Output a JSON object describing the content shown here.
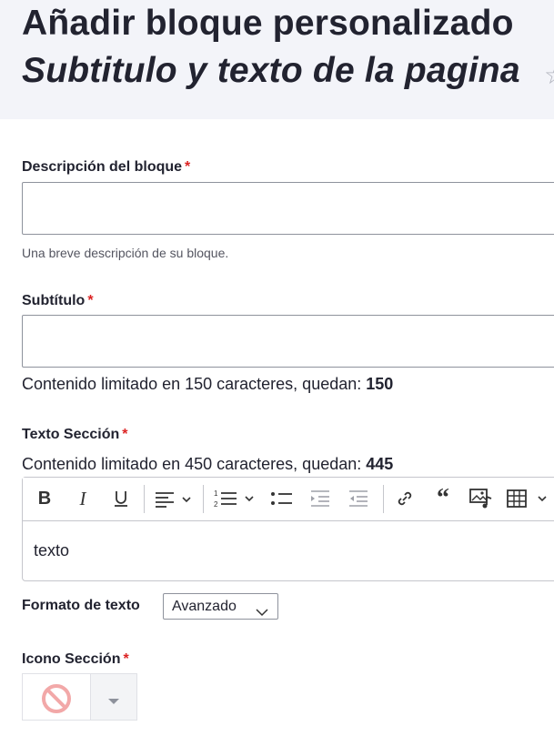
{
  "header": {
    "title": "Añadir bloque personalizado",
    "subtitle": "Subtitulo y texto de la pagina"
  },
  "fields": {
    "descripcion": {
      "label": "Descripción del bloque",
      "required_mark": "*",
      "value": "",
      "help": "Una breve descripción de su bloque."
    },
    "subtitulo": {
      "label": "Subtítulo",
      "required_mark": "*",
      "value": "",
      "counter_prefix": "Contenido limitado en 150 caracteres, quedan:",
      "counter_value": "150"
    },
    "texto_seccion": {
      "label": "Texto Sección",
      "required_mark": "*",
      "counter_prefix": "Contenido limitado en 450 caracteres, quedan:",
      "counter_value": "445",
      "content": "texto"
    },
    "formato": {
      "label": "Formato de texto",
      "selected": "Avanzado"
    },
    "icono": {
      "label": "Icono Sección",
      "required_mark": "*"
    }
  },
  "toolbar_icons": [
    "bold-icon",
    "italic-icon",
    "underline-icon",
    "align-icon",
    "numbered-list-icon",
    "bulleted-list-icon",
    "indent-icon",
    "outdent-icon",
    "link-icon",
    "blockquote-icon",
    "media-icon",
    "table-icon"
  ],
  "colors": {
    "required": "#dc2323",
    "header_bg": "#f3f4f9",
    "no_icon": "#f2a8a8"
  }
}
